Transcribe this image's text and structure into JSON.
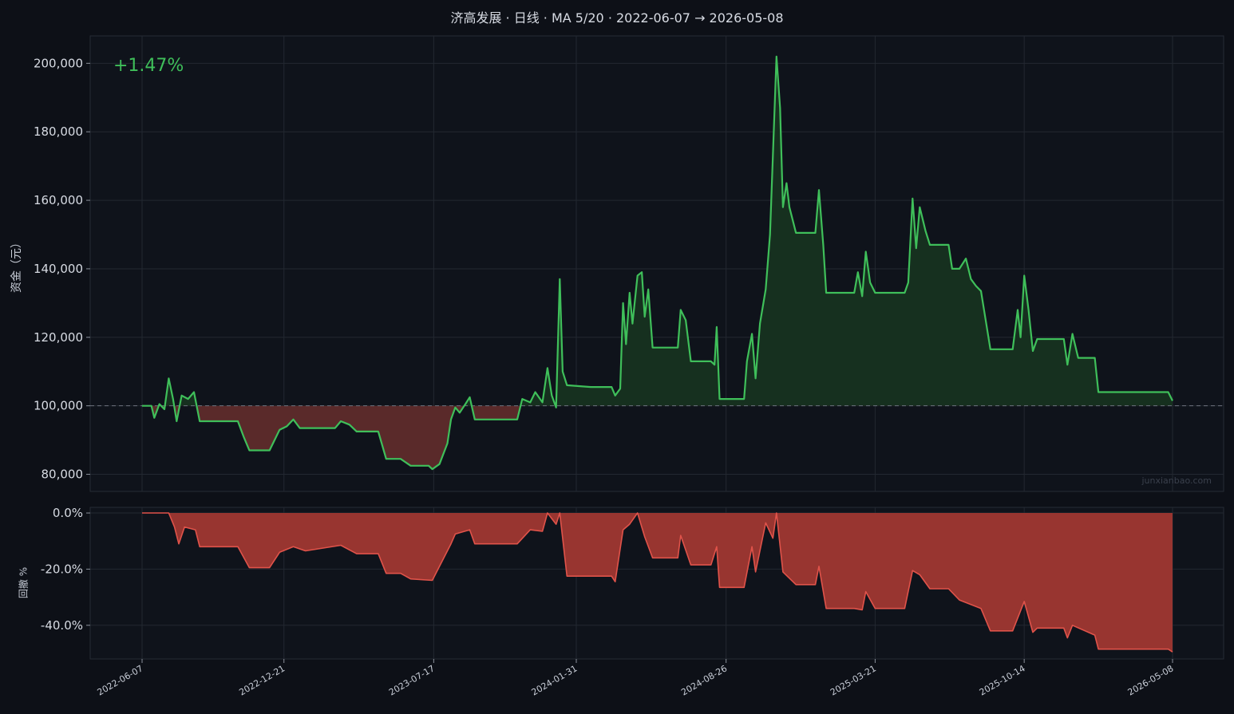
{
  "chart_data": {
    "type": "area",
    "title": "济高发展 · 日线 · MA 5/20 · 2022-06-07 → 2026-05-08",
    "return_label": "+1.47%",
    "watermark": "junxianbao.com",
    "colors": {
      "up": "#3fbf5a",
      "down_fill": "#5a2a2a",
      "drawdown": "#e0534a",
      "background": "#0d1017"
    },
    "x_tick_labels": [
      "2022-06-07",
      "2022-12-21",
      "2023-07-17",
      "2024-01-31",
      "2024-08-26",
      "2025-03-21",
      "2025-10-14",
      "2026-05-08"
    ],
    "equity": {
      "ylabel": "资金（元）",
      "ylim": [
        75000,
        208000
      ],
      "y_ticks": [
        80000,
        100000,
        120000,
        140000,
        160000,
        180000,
        200000
      ],
      "y_tick_labels": [
        "80,000",
        "100,000",
        "120,000",
        "140,000",
        "160,000",
        "180,000",
        "200,000"
      ],
      "baseline": 100000,
      "series": [
        {
          "points": [
            [
              "2022-06-07",
              100000
            ],
            [
              "2022-06-20",
              100000
            ],
            [
              "2022-06-24",
              96500
            ],
            [
              "2022-07-01",
              100500
            ],
            [
              "2022-07-08",
              99000
            ],
            [
              "2022-07-14",
              108000
            ],
            [
              "2022-07-20",
              102000
            ],
            [
              "2022-07-25",
              95500
            ],
            [
              "2022-08-01",
              103000
            ],
            [
              "2022-08-10",
              102000
            ],
            [
              "2022-08-18",
              104000
            ],
            [
              "2022-08-26",
              95500
            ],
            [
              "2022-10-18",
              95500
            ],
            [
              "2022-10-26",
              91000
            ],
            [
              "2022-11-03",
              87000
            ],
            [
              "2022-12-01",
              87000
            ],
            [
              "2022-12-08",
              90000
            ],
            [
              "2022-12-15",
              93000
            ],
            [
              "2022-12-25",
              94000
            ],
            [
              "2023-01-03",
              96000
            ],
            [
              "2023-01-12",
              93500
            ],
            [
              "2023-01-20",
              93500
            ],
            [
              "2023-03-02",
              93500
            ],
            [
              "2023-03-10",
              95500
            ],
            [
              "2023-03-22",
              94500
            ],
            [
              "2023-04-01",
              92500
            ],
            [
              "2023-05-01",
              92500
            ],
            [
              "2023-05-12",
              84500
            ],
            [
              "2023-06-01",
              84500
            ],
            [
              "2023-06-15",
              82500
            ],
            [
              "2023-07-10",
              82500
            ],
            [
              "2023-07-15",
              81500
            ],
            [
              "2023-07-25",
              83000
            ],
            [
              "2023-08-05",
              89000
            ],
            [
              "2023-08-10",
              96000
            ],
            [
              "2023-08-16",
              99500
            ],
            [
              "2023-08-22",
              98000
            ],
            [
              "2023-08-30",
              100500
            ],
            [
              "2023-09-05",
              102500
            ],
            [
              "2023-09-12",
              96000
            ],
            [
              "2023-11-10",
              96000
            ],
            [
              "2023-11-17",
              102000
            ],
            [
              "2023-11-28",
              101000
            ],
            [
              "2023-12-05",
              104000
            ],
            [
              "2023-12-15",
              101000
            ],
            [
              "2023-12-22",
              111000
            ],
            [
              "2023-12-28",
              103000
            ],
            [
              "2024-01-03",
              99500
            ],
            [
              "2024-01-08",
              137000
            ],
            [
              "2024-01-12",
              110000
            ],
            [
              "2024-01-18",
              106000
            ],
            [
              "2024-02-20",
              105500
            ],
            [
              "2024-03-20",
              105500
            ],
            [
              "2024-03-25",
              103000
            ],
            [
              "2024-04-01",
              105000
            ],
            [
              "2024-04-05",
              130000
            ],
            [
              "2024-04-09",
              118000
            ],
            [
              "2024-04-14",
              133000
            ],
            [
              "2024-04-18",
              124000
            ],
            [
              "2024-04-25",
              138000
            ],
            [
              "2024-05-01",
              139000
            ],
            [
              "2024-05-05",
              126000
            ],
            [
              "2024-05-10",
              134000
            ],
            [
              "2024-05-16",
              117000
            ],
            [
              "2024-06-20",
              117000
            ],
            [
              "2024-06-24",
              128000
            ],
            [
              "2024-07-01",
              125000
            ],
            [
              "2024-07-08",
              113000
            ],
            [
              "2024-08-05",
              113000
            ],
            [
              "2024-08-10",
              112000
            ],
            [
              "2024-08-13",
              123000
            ],
            [
              "2024-08-17",
              102000
            ],
            [
              "2024-09-20",
              102000
            ],
            [
              "2024-09-24",
              113000
            ],
            [
              "2024-10-01",
              121000
            ],
            [
              "2024-10-06",
              108000
            ],
            [
              "2024-10-12",
              124000
            ],
            [
              "2024-10-20",
              134000
            ],
            [
              "2024-10-26",
              150000
            ],
            [
              "2024-10-30",
              173000
            ],
            [
              "2024-11-04",
              202000
            ],
            [
              "2024-11-09",
              187000
            ],
            [
              "2024-11-13",
              158000
            ],
            [
              "2024-11-18",
              165000
            ],
            [
              "2024-11-22",
              158000
            ],
            [
              "2024-12-01",
              150500
            ],
            [
              "2024-12-28",
              150500
            ],
            [
              "2025-01-02",
              163000
            ],
            [
              "2025-01-08",
              147000
            ],
            [
              "2025-01-12",
              133000
            ],
            [
              "2025-02-20",
              133000
            ],
            [
              "2025-02-25",
              139000
            ],
            [
              "2025-03-03",
              132000
            ],
            [
              "2025-03-08",
              145000
            ],
            [
              "2025-03-14",
              136000
            ],
            [
              "2025-03-21",
              133000
            ],
            [
              "2025-05-01",
              133000
            ],
            [
              "2025-05-06",
              136000
            ],
            [
              "2025-05-12",
              160500
            ],
            [
              "2025-05-17",
              146000
            ],
            [
              "2025-05-22",
              158000
            ],
            [
              "2025-05-30",
              151000
            ],
            [
              "2025-06-05",
              147000
            ],
            [
              "2025-07-01",
              147000
            ],
            [
              "2025-07-06",
              140000
            ],
            [
              "2025-07-16",
              140000
            ],
            [
              "2025-07-25",
              143000
            ],
            [
              "2025-08-01",
              137000
            ],
            [
              "2025-08-08",
              135000
            ],
            [
              "2025-08-15",
              133500
            ],
            [
              "2025-08-28",
              116500
            ],
            [
              "2025-09-28",
              116500
            ],
            [
              "2025-10-05",
              128000
            ],
            [
              "2025-10-09",
              120000
            ],
            [
              "2025-10-14",
              138000
            ],
            [
              "2025-10-20",
              128000
            ],
            [
              "2025-10-26",
              116000
            ],
            [
              "2025-11-01",
              119500
            ],
            [
              "2025-12-08",
              119500
            ],
            [
              "2025-12-13",
              112000
            ],
            [
              "2025-12-20",
              121000
            ],
            [
              "2025-12-28",
              114000
            ],
            [
              "2026-01-20",
              114000
            ],
            [
              "2026-01-25",
              104000
            ],
            [
              "2026-05-02",
              104000
            ],
            [
              "2026-05-08",
              101470
            ]
          ]
        }
      ]
    },
    "drawdown": {
      "ylabel": "回撤 %",
      "ylim": [
        -52,
        2
      ],
      "y_ticks": [
        0,
        -20,
        -40
      ],
      "y_tick_labels": [
        "0.0%",
        "-20.0%",
        "-40.0%"
      ],
      "series": [
        {
          "points": [
            [
              "2022-06-07",
              0
            ],
            [
              "2022-07-14",
              0
            ],
            [
              "2022-07-22",
              -5
            ],
            [
              "2022-07-28",
              -11
            ],
            [
              "2022-08-05",
              -5
            ],
            [
              "2022-08-20",
              -6
            ],
            [
              "2022-08-26",
              -12
            ],
            [
              "2022-10-18",
              -12
            ],
            [
              "2022-11-03",
              -19.5
            ],
            [
              "2022-12-01",
              -19.5
            ],
            [
              "2022-12-15",
              -14
            ],
            [
              "2023-01-03",
              -12
            ],
            [
              "2023-01-20",
              -13.5
            ],
            [
              "2023-03-10",
              -11.5
            ],
            [
              "2023-04-01",
              -14.5
            ],
            [
              "2023-05-01",
              -14.5
            ],
            [
              "2023-05-12",
              -21.5
            ],
            [
              "2023-06-01",
              -21.5
            ],
            [
              "2023-06-15",
              -23.5
            ],
            [
              "2023-07-15",
              -24
            ],
            [
              "2023-08-10",
              -11
            ],
            [
              "2023-08-16",
              -7.5
            ],
            [
              "2023-09-05",
              -6
            ],
            [
              "2023-09-12",
              -11
            ],
            [
              "2023-11-10",
              -11
            ],
            [
              "2023-11-28",
              -6
            ],
            [
              "2023-12-15",
              -6.5
            ],
            [
              "2023-12-22",
              0
            ],
            [
              "2024-01-03",
              -4
            ],
            [
              "2024-01-08",
              0
            ],
            [
              "2024-01-18",
              -22.5
            ],
            [
              "2024-03-20",
              -22.5
            ],
            [
              "2024-03-25",
              -24.5
            ],
            [
              "2024-04-05",
              -6
            ],
            [
              "2024-04-14",
              -4
            ],
            [
              "2024-04-25",
              0
            ],
            [
              "2024-05-05",
              -8.5
            ],
            [
              "2024-05-16",
              -16
            ],
            [
              "2024-06-20",
              -16
            ],
            [
              "2024-06-24",
              -8
            ],
            [
              "2024-07-08",
              -18.5
            ],
            [
              "2024-08-05",
              -18.5
            ],
            [
              "2024-08-13",
              -12
            ],
            [
              "2024-08-17",
              -26.5
            ],
            [
              "2024-09-20",
              -26.5
            ],
            [
              "2024-10-01",
              -12
            ],
            [
              "2024-10-06",
              -21
            ],
            [
              "2024-10-20",
              -3.5
            ],
            [
              "2024-10-30",
              -9
            ],
            [
              "2024-11-04",
              0
            ],
            [
              "2024-11-13",
              -21
            ],
            [
              "2024-12-01",
              -25.5
            ],
            [
              "2024-12-28",
              -25.5
            ],
            [
              "2025-01-02",
              -19
            ],
            [
              "2025-01-12",
              -34
            ],
            [
              "2025-02-20",
              -34
            ],
            [
              "2025-03-03",
              -34.5
            ],
            [
              "2025-03-08",
              -28
            ],
            [
              "2025-03-21",
              -34
            ],
            [
              "2025-05-01",
              -34
            ],
            [
              "2025-05-12",
              -20.5
            ],
            [
              "2025-05-22",
              -22
            ],
            [
              "2025-06-05",
              -27
            ],
            [
              "2025-07-01",
              -27
            ],
            [
              "2025-07-16",
              -31
            ],
            [
              "2025-08-15",
              -34
            ],
            [
              "2025-08-28",
              -42
            ],
            [
              "2025-09-28",
              -42
            ],
            [
              "2025-10-14",
              -31.5
            ],
            [
              "2025-10-26",
              -42.5
            ],
            [
              "2025-11-01",
              -41
            ],
            [
              "2025-12-08",
              -41
            ],
            [
              "2025-12-13",
              -44.5
            ],
            [
              "2025-12-20",
              -40
            ],
            [
              "2026-01-20",
              -43.5
            ],
            [
              "2026-01-25",
              -48.5
            ],
            [
              "2026-05-02",
              -48.5
            ],
            [
              "2026-05-08",
              -49.5
            ]
          ]
        }
      ]
    }
  }
}
